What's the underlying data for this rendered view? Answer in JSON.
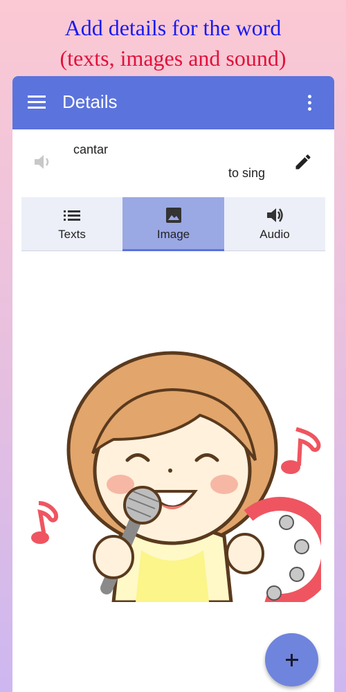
{
  "promo": {
    "line1": "Add details for the word",
    "line2": "(texts, images and sound)"
  },
  "appbar": {
    "title": "Details",
    "menu_icon": "hamburger-menu-icon",
    "more_icon": "more-vertical-icon",
    "color": "#5b73dc"
  },
  "entry": {
    "word": "cantar",
    "translation": "to sing",
    "speaker_icon": "speaker-icon",
    "edit_icon": "pencil-icon"
  },
  "tabs": [
    {
      "label": "Texts",
      "icon": "list-icon",
      "selected": false
    },
    {
      "label": "Image",
      "icon": "image-icon",
      "selected": true
    },
    {
      "label": "Audio",
      "icon": "volume-icon",
      "selected": false
    }
  ],
  "content": {
    "illustration": "girl-singing-with-microphone-and-tambourine"
  },
  "fab": {
    "icon": "plus-icon"
  }
}
